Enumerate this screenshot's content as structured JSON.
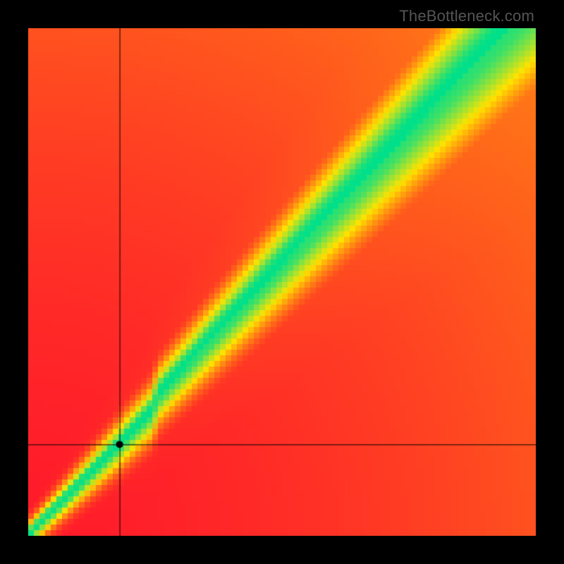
{
  "watermark": "TheBottleneck.com",
  "chart_data": {
    "type": "heatmap",
    "title": "",
    "xlabel": "",
    "ylabel": "",
    "xlim": [
      0,
      1
    ],
    "ylim": [
      0,
      1
    ],
    "point": {
      "x": 0.18,
      "y": 0.18
    },
    "crosshair": {
      "x": 0.18,
      "y": 0.18
    },
    "ideal_band": {
      "description": "optimal diagonal band where balance is best",
      "center_slope": 1.05,
      "half_width_fraction": 0.07
    },
    "color_scale": {
      "low": "#ff1a2b",
      "mid": "#ffe400",
      "high": "#00e08a",
      "meaning": "red = severe bottleneck, yellow = moderate, green = balanced"
    },
    "grid": false,
    "legend": false
  }
}
